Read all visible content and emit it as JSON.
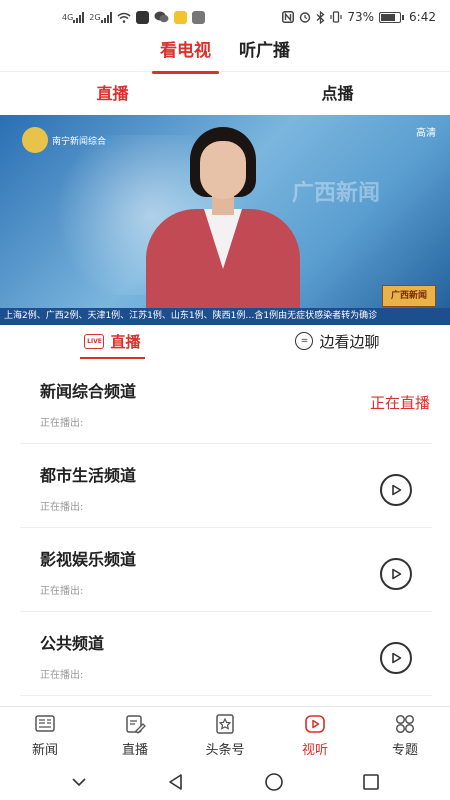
{
  "status_bar": {
    "network_1": "4G",
    "network_2": "2G",
    "battery": "73%",
    "time": "6:42"
  },
  "top_tabs": [
    {
      "label": "看电视",
      "active": true
    },
    {
      "label": "听广播",
      "active": false
    }
  ],
  "sub_tabs": [
    {
      "label": "直播",
      "active": true
    },
    {
      "label": "点播",
      "active": false
    }
  ],
  "video": {
    "channel_logo_text": "南宁新闻综合",
    "hd_label": "高清",
    "bg_text": "广西新闻",
    "ticker_logo": "广西新闻",
    "ticker_text": "上海2例、广西2例、天津1例、江苏1例、山东1例、陕西1例…含1例由无症状感染者转为确诊"
  },
  "mode_tabs": [
    {
      "label": "直播",
      "icon": "live-icon",
      "active": true
    },
    {
      "label": "边看边聊",
      "icon": "chat-icon",
      "active": false
    }
  ],
  "channels": [
    {
      "name": "新闻综合频道",
      "sub": "正在播出:",
      "status": "正在直播"
    },
    {
      "name": "都市生活频道",
      "sub": "正在播出:",
      "status": ""
    },
    {
      "name": "影视娱乐频道",
      "sub": "正在播出:",
      "status": ""
    },
    {
      "name": "公共频道",
      "sub": "正在播出:",
      "status": ""
    }
  ],
  "bottom_nav": [
    {
      "label": "新闻",
      "icon": "news-icon",
      "active": false
    },
    {
      "label": "直播",
      "icon": "live-edit-icon",
      "active": false
    },
    {
      "label": "头条号",
      "icon": "star-badge-icon",
      "active": false
    },
    {
      "label": "视听",
      "icon": "video-play-icon",
      "active": true
    },
    {
      "label": "专题",
      "icon": "grid-icon",
      "active": false
    }
  ],
  "colors": {
    "accent": "#d9312b"
  }
}
